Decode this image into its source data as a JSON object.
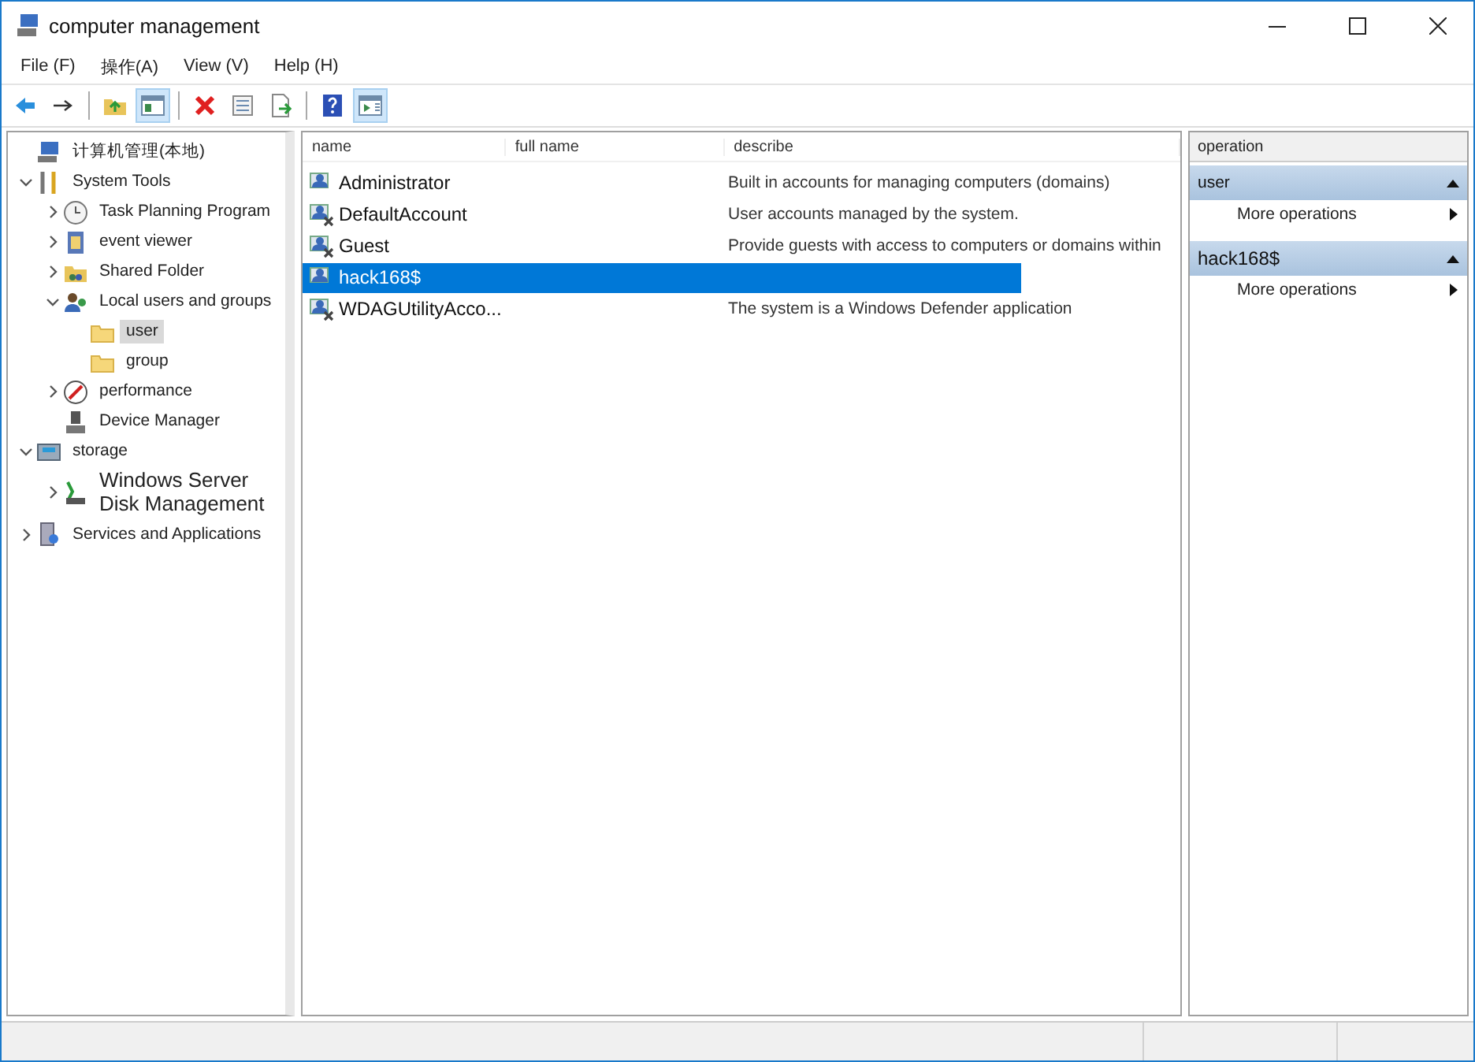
{
  "window": {
    "title": "computer management"
  },
  "menu": [
    "File (F)",
    "操作(A)",
    "View (V)",
    "Help (H)"
  ],
  "toolbar": [
    {
      "kind": "back",
      "pressed": false
    },
    {
      "kind": "forward",
      "pressed": false
    },
    {
      "kind": "sep"
    },
    {
      "kind": "up",
      "pressed": false
    },
    {
      "kind": "tree",
      "pressed": true
    },
    {
      "kind": "sep"
    },
    {
      "kind": "delete",
      "pressed": false
    },
    {
      "kind": "properties",
      "pressed": false
    },
    {
      "kind": "export",
      "pressed": false
    },
    {
      "kind": "sep"
    },
    {
      "kind": "help",
      "pressed": false
    },
    {
      "kind": "actions",
      "pressed": true
    }
  ],
  "tree": [
    {
      "label": "计算机管理(本地)",
      "kind": "computer",
      "selected": false,
      "children": [
        {
          "label": "System Tools",
          "kind": "tools",
          "expanded": true,
          "selected": false,
          "children": [
            {
              "label": "Task Planning Program",
              "kind": "clock",
              "expanded": false,
              "selected": false
            },
            {
              "label": "event viewer",
              "kind": "log",
              "expanded": false,
              "selected": false
            },
            {
              "label": "Shared Folder",
              "kind": "share",
              "expanded": false,
              "selected": false
            },
            {
              "label": "Local users and groups",
              "kind": "users",
              "expanded": true,
              "selected": false,
              "children": [
                {
                  "label": "user",
                  "kind": "folder",
                  "selected": true
                },
                {
                  "label": "group",
                  "kind": "folder",
                  "selected": false
                }
              ]
            },
            {
              "label": "performance",
              "kind": "gauge",
              "expanded": false,
              "selected": false
            },
            {
              "label": "Device Manager",
              "kind": "device",
              "selected": false
            }
          ]
        },
        {
          "label": "storage",
          "kind": "storage",
          "expanded": true,
          "selected": false,
          "children": [
            {
              "label": "Windows Server Disk Management",
              "kind": "disk",
              "expanded": false,
              "selected": false
            }
          ]
        },
        {
          "label": "Services and Applications",
          "kind": "services",
          "expanded": false,
          "selected": false
        }
      ]
    }
  ],
  "table": {
    "columns": [
      "name",
      "full name",
      "describe"
    ],
    "rows": [
      {
        "name": "Administrator",
        "describe": "Built in accounts for managing computers (domains)",
        "disabled": false,
        "selected": false
      },
      {
        "name": "DefaultAccount",
        "describe": "User accounts managed by the system.",
        "disabled": true,
        "selected": false
      },
      {
        "name": "Guest",
        "describe": "Provide guests with access to computers or domains within",
        "disabled": true,
        "selected": false
      },
      {
        "name": "hack168$",
        "disabled": false,
        "selected": true
      },
      {
        "name": "WDAGUtilityAcco...",
        "describe": "The system is a Windows Defender application",
        "disabled": true,
        "selected": false
      }
    ]
  },
  "actions": {
    "title": "operation",
    "sections": [
      {
        "heading": "user",
        "items": [
          "More operations"
        ]
      },
      {
        "heading": "hack168$",
        "items": [
          "More operations"
        ]
      }
    ]
  }
}
